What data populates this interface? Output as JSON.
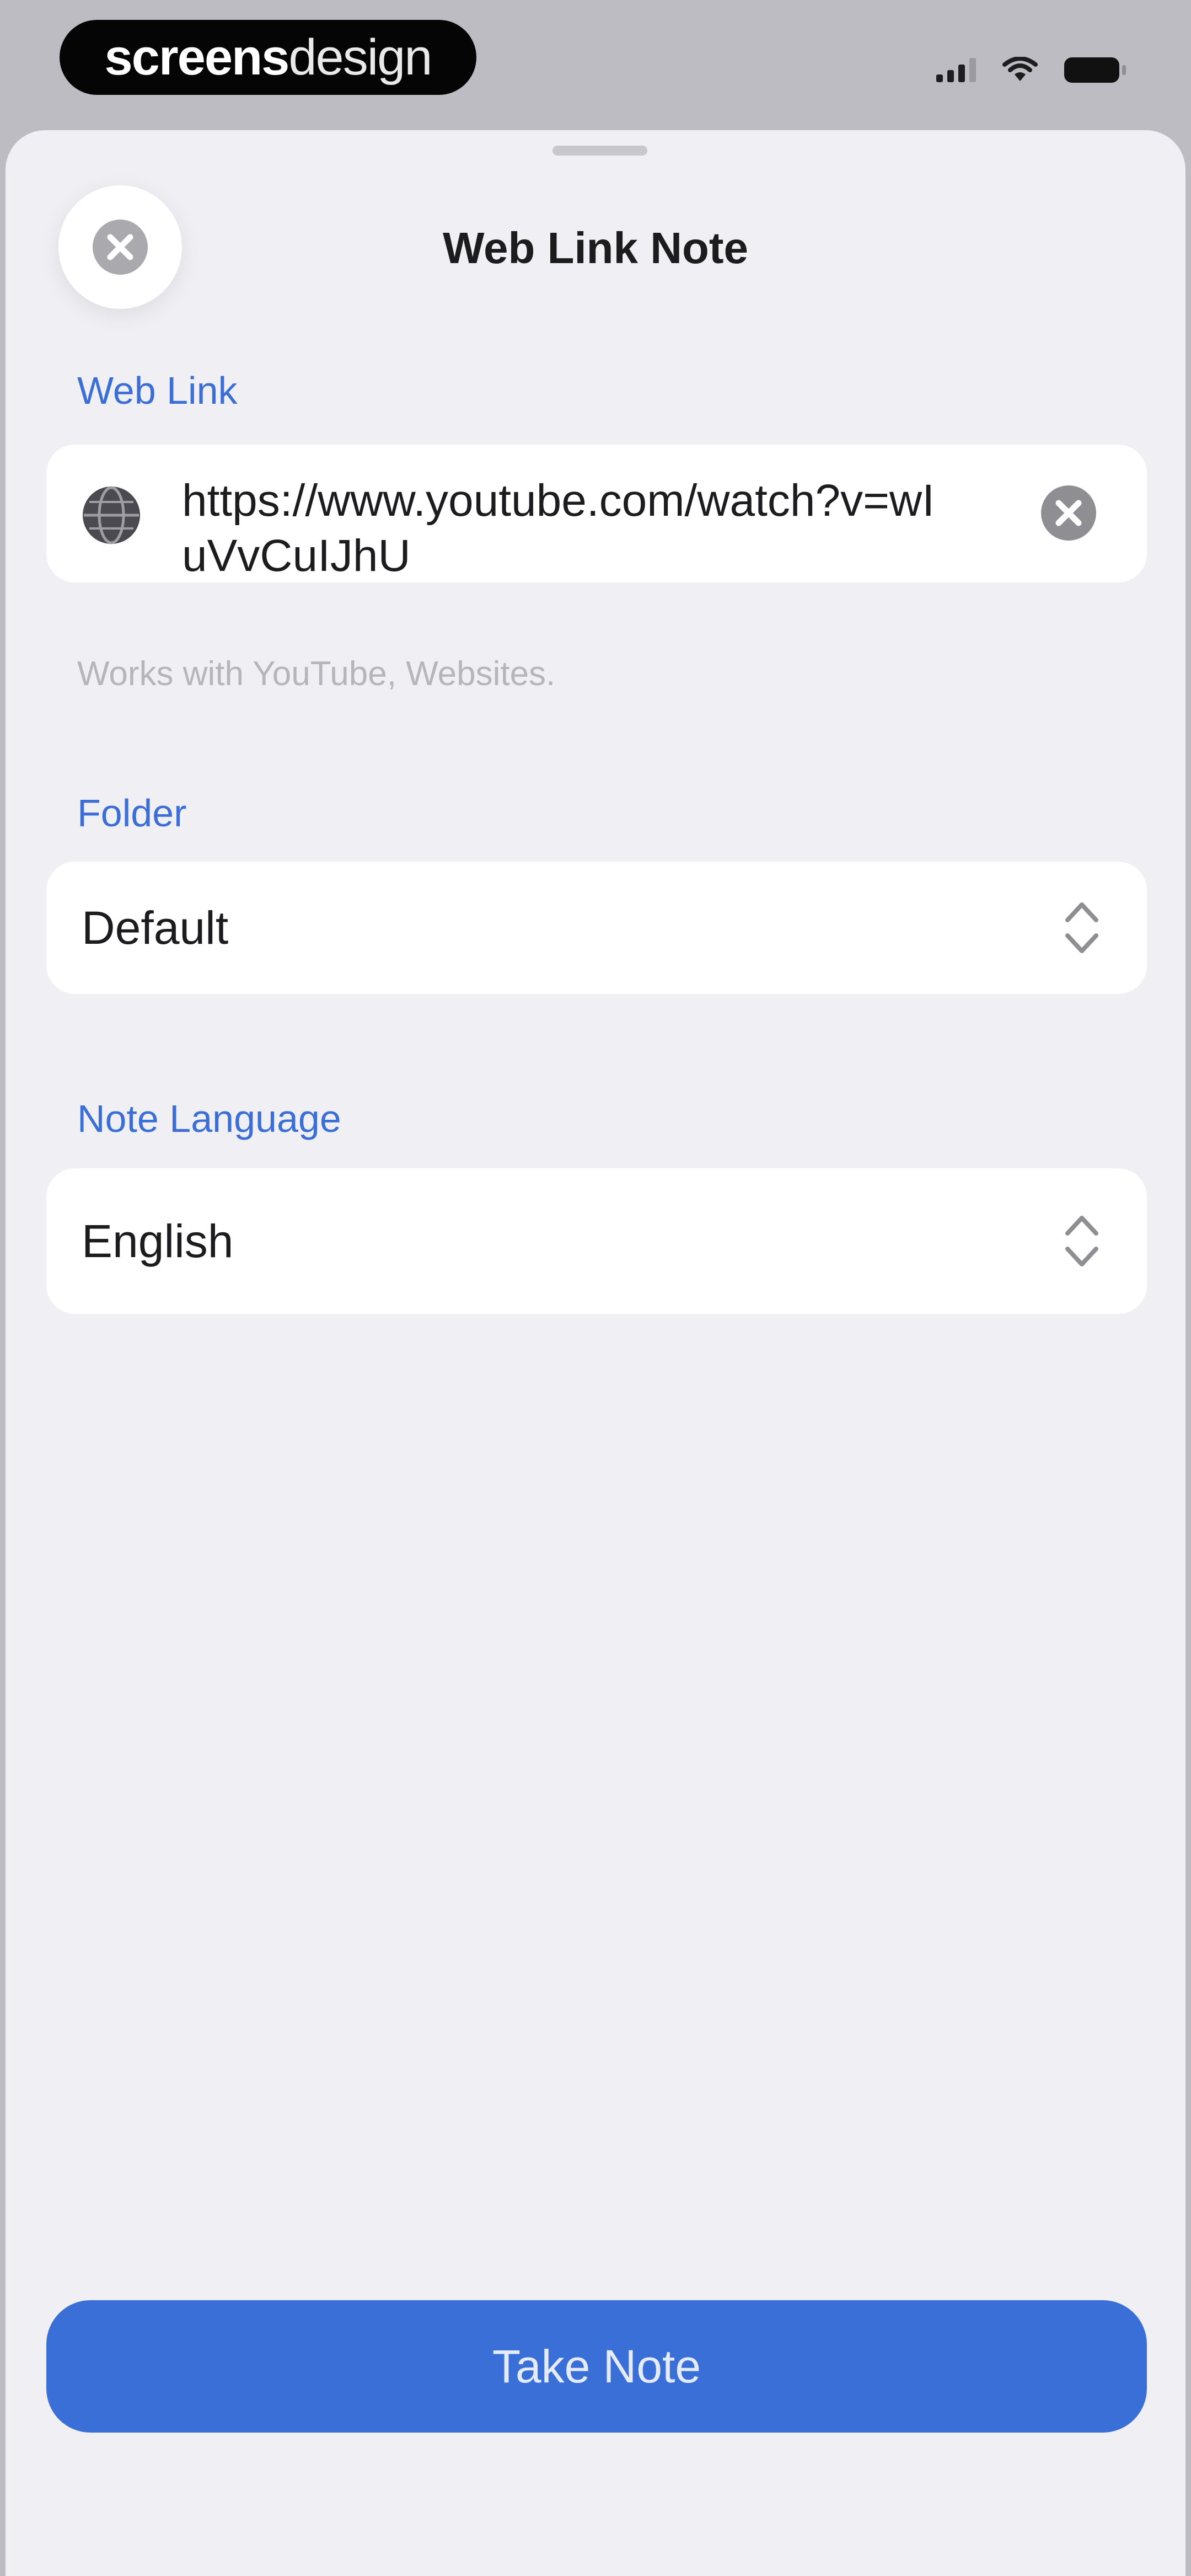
{
  "status_bar": {
    "brand_strong": "screens",
    "brand_light": "design",
    "icons": [
      "signal-icon",
      "wifi-icon",
      "battery-icon"
    ]
  },
  "sheet": {
    "title": "Web Link Note",
    "close_icon": "close-icon"
  },
  "web_link": {
    "label": "Web Link",
    "value": "https://www.youtube.com/watch?v=wIuVvCuIJhU",
    "icon": "globe-icon",
    "clear_icon": "clear-icon",
    "hint": "Works with YouTube, Websites."
  },
  "folder": {
    "label": "Folder",
    "value": "Default",
    "icon": "chevron-updown-icon"
  },
  "language": {
    "label": "Note Language",
    "value": "English",
    "icon": "chevron-updown-icon"
  },
  "actions": {
    "take_note": "Take Note"
  },
  "colors": {
    "accent": "#3a6fd8",
    "label": "#3b6fd6",
    "background": "#efeff4",
    "card": "#ffffff"
  }
}
